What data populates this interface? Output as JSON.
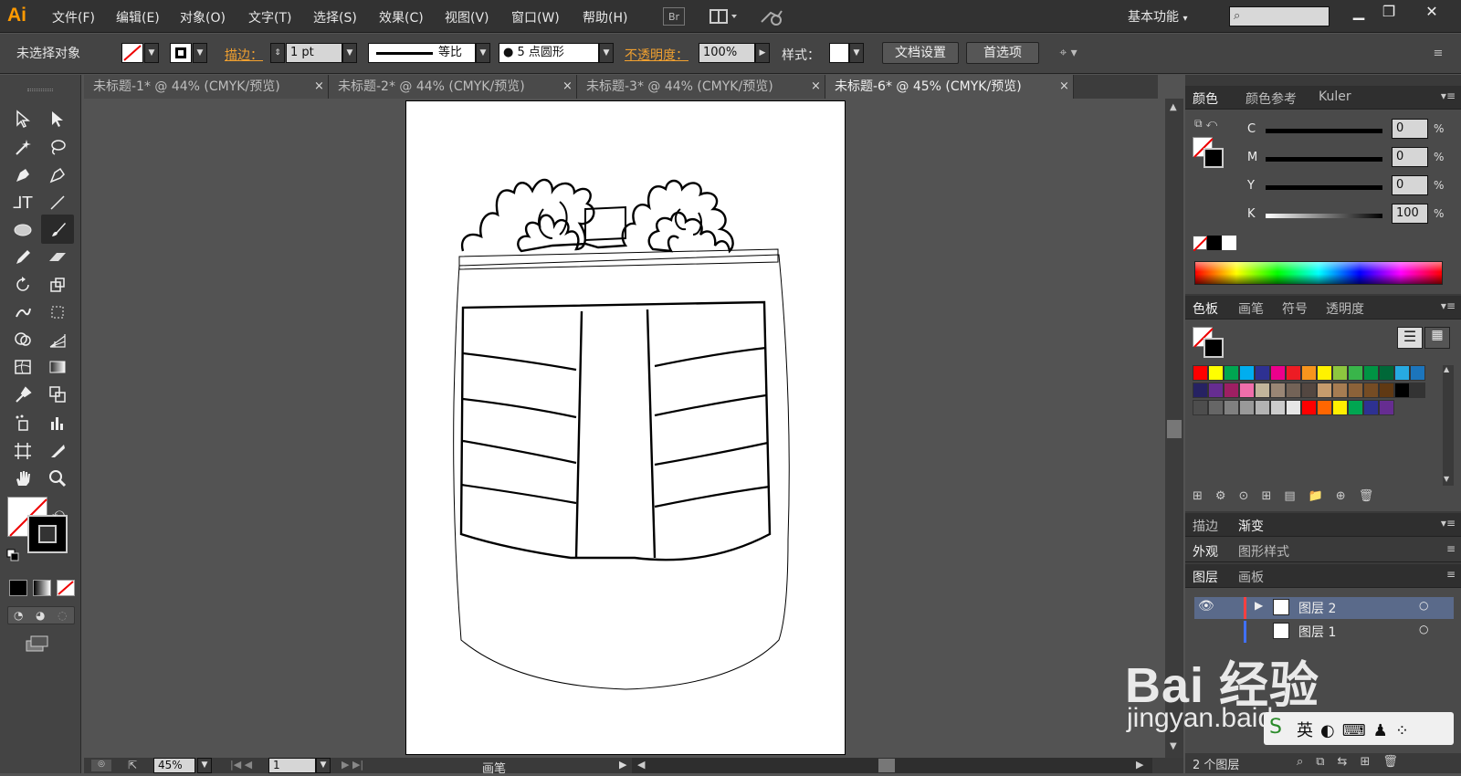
{
  "app": {
    "logo": "Ai",
    "workspace": "基本功能",
    "menus": [
      "文件(F)",
      "编辑(E)",
      "对象(O)",
      "文字(T)",
      "选择(S)",
      "效果(C)",
      "视图(V)",
      "窗口(W)",
      "帮助(H)"
    ],
    "bridge": "Br"
  },
  "window_controls": {
    "minimize": "▁",
    "restore": "❐",
    "close": "✕"
  },
  "control_bar": {
    "selection": "未选择对象",
    "stroke_label": "描边：",
    "stroke_weight": "1 pt",
    "profile": "等比",
    "brush": "●  5 点圆形",
    "opacity_label": "不透明度：",
    "opacity": "100%",
    "style_label": "样式：",
    "doc_setup": "文档设置",
    "preferences": "首选项"
  },
  "tabs": [
    {
      "label": "未标题-1* @ 44% (CMYK/预览)"
    },
    {
      "label": "未标题-2* @ 44% (CMYK/预览)"
    },
    {
      "label": "未标题-3* @ 44% (CMYK/预览)"
    },
    {
      "label": "未标题-6* @ 45% (CMYK/预览)"
    }
  ],
  "tab_close": "×",
  "status": {
    "zoom": "45%",
    "page": "1",
    "tool": "画笔"
  },
  "color_panel": {
    "tabs": [
      "颜色",
      "颜色参考",
      "Kuler"
    ],
    "channels": [
      {
        "name": "C",
        "value": "0"
      },
      {
        "name": "M",
        "value": "0"
      },
      {
        "name": "Y",
        "value": "0"
      },
      {
        "name": "K",
        "value": "100"
      }
    ],
    "pct": "%"
  },
  "swatches_panel": {
    "tabs": [
      "色板",
      "画笔",
      "符号",
      "透明度"
    ]
  },
  "stroke_panel": {
    "tabs": [
      "描边",
      "渐变"
    ]
  },
  "appearance_panel": {
    "tabs": [
      "外观",
      "图形样式"
    ]
  },
  "layers_panel": {
    "tabs": [
      "图层",
      "画板"
    ],
    "layers": [
      {
        "name": "图层 2"
      },
      {
        "name": "图层 1"
      }
    ],
    "count": "2 个图层"
  },
  "watermark": {
    "main": "Bai 经验",
    "url": "jingyan.baidu.com"
  },
  "swatch_colors": [
    "#ff0000",
    "#ffff00",
    "#00a651",
    "#00aeef",
    "#2e3192",
    "#ec008c",
    "#ed1c24",
    "#f7941d",
    "#fff200",
    "#8dc63f",
    "#39b54a",
    "#009444",
    "#006838",
    "#27aae1",
    "#1c75bc",
    "#262262",
    "#662d91",
    "#9e1f63",
    "#f06eaa",
    "#c2b59b",
    "#998675",
    "#736357",
    "#534741",
    "#c69c6d",
    "#a67c52",
    "#8c6239",
    "#754c24",
    "#603913",
    "#000000",
    "#333333",
    "#4d4d4d",
    "#666666",
    "#808080",
    "#999999",
    "#b3b3b3",
    "#cccccc",
    "#e6e6e6",
    "#ff0000",
    "#ff6600",
    "#ffee00",
    "#00a651",
    "#2e3192",
    "#662d91"
  ]
}
